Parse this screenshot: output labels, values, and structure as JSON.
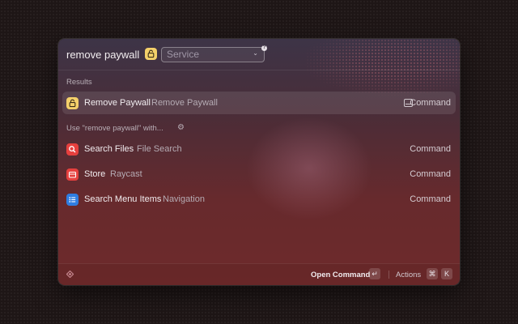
{
  "search": {
    "query": "remove paywall",
    "service_placeholder": "Service",
    "help_badge": "?"
  },
  "sections": {
    "results": "Results",
    "fallback": "Use \"remove paywall\" with..."
  },
  "results": [
    {
      "title": "Remove Paywall",
      "subtitle": "Remove Paywall",
      "accessory": "Command",
      "icon": "lock-icon",
      "color": "#f4d06a"
    }
  ],
  "fallbacks": [
    {
      "title": "Search Files",
      "subtitle": "File Search",
      "accessory": "Command",
      "icon": "magnifier-icon",
      "color": "#e6403e"
    },
    {
      "title": "Store",
      "subtitle": "Raycast",
      "accessory": "Command",
      "icon": "store-icon",
      "color": "#e6403e"
    },
    {
      "title": "Search Menu Items",
      "subtitle": "Navigation",
      "accessory": "Command",
      "icon": "menu-list-icon",
      "color": "#2f7de1"
    }
  ],
  "footer": {
    "primary_action": "Open Command",
    "primary_key": "↵",
    "actions_label": "Actions",
    "actions_keys": [
      "⌘",
      "K"
    ]
  },
  "colors": {
    "accent_yellow": "#f4d06a",
    "accent_red": "#e6403e",
    "accent_blue": "#2f7de1"
  }
}
